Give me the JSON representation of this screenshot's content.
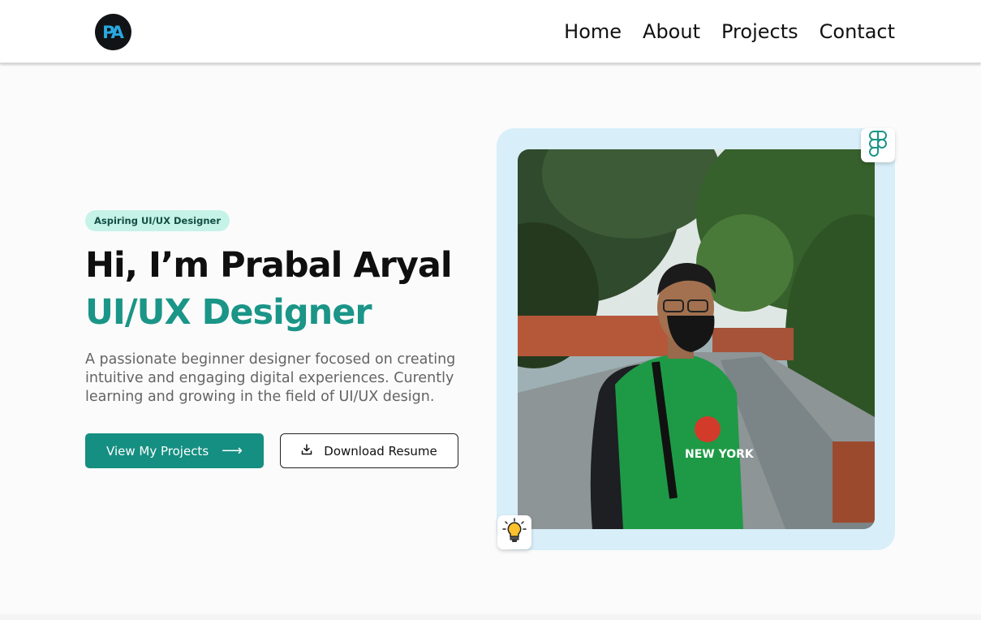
{
  "header": {
    "logo_text": "PA",
    "nav": [
      {
        "label": "Home"
      },
      {
        "label": "About"
      },
      {
        "label": "Projects"
      },
      {
        "label": "Contact"
      }
    ]
  },
  "hero": {
    "badge": "Aspiring UI/UX Designer",
    "greeting": "Hi, I’m Prabal Aryal",
    "role": "UI/UX Designer",
    "description": "A passionate beginner designer focosed on creating intuitive and engaging digital experiences. Curently learning and growing in the field of UI/UX design.",
    "primary_button": "View My Projects",
    "secondary_button": "Download Resume",
    "shirt_text": "NEW YORK"
  },
  "icons": {
    "primary_arrow": "arrow-right-icon",
    "download": "download-icon",
    "figma": "figma-icon",
    "bulb": "lightbulb-icon"
  },
  "colors": {
    "accent": "#158f81",
    "role_text": "#1a9587",
    "badge_bg": "#c6f3e8",
    "frame_bg": "#d8eef8",
    "logo_text": "#2aa8e0"
  }
}
